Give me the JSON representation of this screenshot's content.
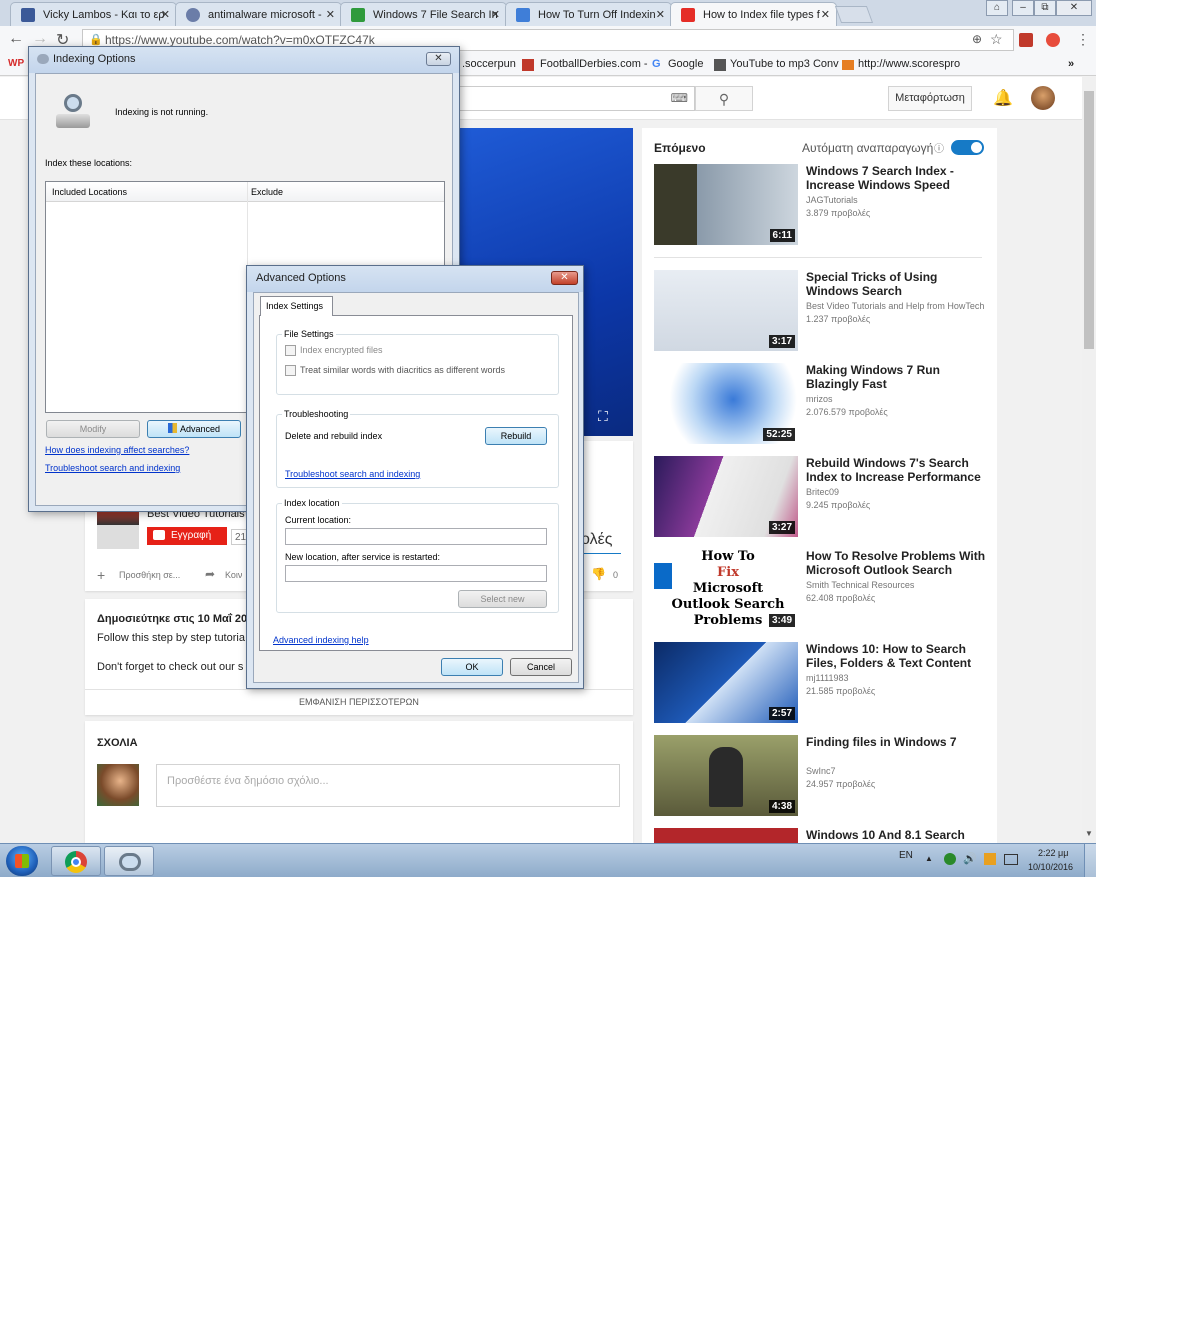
{
  "tabs": [
    {
      "label": "Vicky Lambos - Και το ερ",
      "fav_color": "#3b5998"
    },
    {
      "label": "antimalware microsoft - ",
      "fav_color": "#6b7da8"
    },
    {
      "label": "Windows 7 File Search In",
      "fav_color": "#2f9a3c"
    },
    {
      "label": "How To Turn Off Indexin",
      "fav_color": "#3f7ed8"
    },
    {
      "label": "How to Index file types f",
      "fav_color": "#e52d27"
    }
  ],
  "window_buttons": {
    "user": "⌂",
    "minimize": "–",
    "restore": "⧉",
    "close": "✕"
  },
  "address": {
    "url": "https://www.youtube.com/watch?v=m0xOTFZC47k"
  },
  "bookmarks": [
    {
      "label": "WP",
      "color": "#d62b2b"
    },
    {
      "label": ".soccerpun"
    },
    {
      "label": "FootballDerbies.com -"
    },
    {
      "label": "Google"
    },
    {
      "label": "YouTube to mp3 Conv"
    },
    {
      "label": "http://www.scorespro"
    },
    {
      "label": "»"
    }
  ],
  "youtube": {
    "upload_label": "Μεταφόρτωση",
    "channel": {
      "name": "Best Video Tutorials",
      "subscribe_label": "Εγγραφή",
      "subscribers": "21.74",
      "views_fragment": "ολές"
    },
    "actions": {
      "add_label": "Προσθήκη σε...",
      "share_label": "Κοιν",
      "dislikes": "0"
    },
    "description": {
      "published": "Δημοσιεύτηκε στις 10 Μαΐ 20",
      "line1": "Follow this step by step tutoria",
      "line2": "Don't forget to check out our s",
      "show_more": "ΕΜΦΑΝΙΣΗ ΠΕΡΙΣΣΟΤΕΡΩΝ"
    },
    "comments": {
      "title": "ΣΧΟΛΙΑ",
      "placeholder": "Προσθέστε ένα δημόσιο σχόλιο..."
    },
    "up_next": {
      "title": "Επόμενο",
      "autoplay_label": "Αυτόματη αναπαραγωγή",
      "autoplay_on": true,
      "videos": [
        {
          "title": "Windows 7 Search Index - Increase Windows Speed",
          "channel": "JAGTutorials",
          "views": "3.879 προβολές",
          "duration": "6:11",
          "thumb_color": "#3a3a3a"
        },
        {
          "title": "Special Tricks of Using Windows Search",
          "channel": "Best Video Tutorials and Help from HowTech",
          "views": "1.237 προβολές",
          "duration": "3:17",
          "thumb_color": "#e8edf3"
        },
        {
          "title": "Making Windows 7 Run Blazingly Fast",
          "channel": "mrizos",
          "views": "2.076.579 προβολές",
          "duration": "52:25",
          "thumb_color": "#ffffff"
        },
        {
          "title": "Rebuild Windows 7's Search Index to Increase Performance",
          "channel": "Britec09",
          "views": "9.245 προβολές",
          "duration": "3:27",
          "thumb_color": "#5a2a7a"
        },
        {
          "title": "How To Resolve Problems With Microsoft Outlook Search",
          "channel": "Smith Technical Resources",
          "views": "62.408 προβολές",
          "duration": "3:49",
          "thumb_color": "#ffffff",
          "thumb_text": [
            "How To",
            "Fix",
            "Microsoft",
            "Outlook Search",
            "Problems"
          ]
        },
        {
          "title": "Windows 10: How to Search Files, Folders & Text Content",
          "channel": "mj1111983",
          "views": "21.585 προβολές",
          "duration": "2:57",
          "thumb_color": "#123a7a"
        },
        {
          "title": "Finding files in Windows 7",
          "channel": "SwInc7",
          "views": "24.957 προβολές",
          "duration": "4:38",
          "thumb_color": "#8a8a4a"
        },
        {
          "title": "Windows 10 And 8.1 Search",
          "channel": "",
          "views": "",
          "duration": "",
          "thumb_color": "#b3262a"
        }
      ]
    }
  },
  "indexing_options": {
    "title": "Indexing Options",
    "status": "Indexing is not running.",
    "index_locations_label": "Index these locations:",
    "columns": [
      "Included Locations",
      "Exclude"
    ],
    "modify_label": "Modify",
    "advanced_label": "Advanced",
    "link1": "How does indexing affect searches?",
    "link2": "Troubleshoot search and indexing"
  },
  "advanced_options": {
    "title": "Advanced Options",
    "tab_label": "Index Settings",
    "file_settings": {
      "title": "File Settings",
      "encrypt_label": "Index encrypted files",
      "encrypt_checked": false,
      "diacritics_label": "Treat similar words with diacritics as different words",
      "diacritics_checked": false
    },
    "troubleshooting": {
      "title": "Troubleshooting",
      "rebuild_text": "Delete and rebuild index",
      "rebuild_label": "Rebuild",
      "link": "Troubleshoot search and indexing"
    },
    "index_location": {
      "title": "Index location",
      "current_label": "Current location:",
      "current_value": "",
      "new_label": "New location, after service is restarted:",
      "new_value": "",
      "select_new_label": "Select new"
    },
    "help_link": "Advanced indexing help",
    "ok_label": "OK",
    "cancel_label": "Cancel"
  },
  "taskbar": {
    "language": "EN",
    "time": "2:22 μμ",
    "date": "10/10/2016"
  }
}
